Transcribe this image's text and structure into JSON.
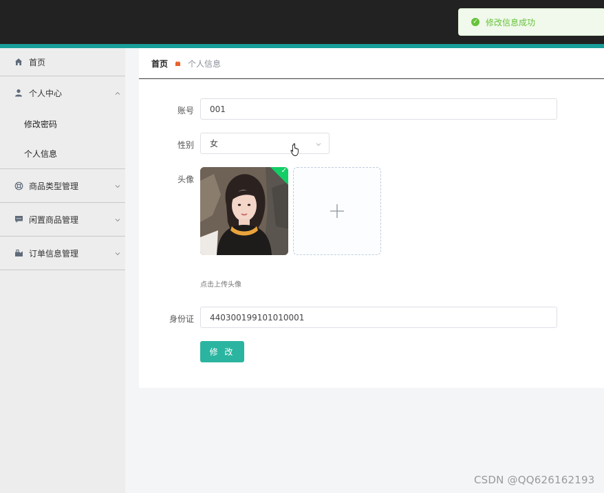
{
  "toast": {
    "message": "修改信息成功",
    "color": "#67c23a"
  },
  "theme": {
    "topbar": "#222222",
    "accent": "#179f9a",
    "button": "#2bb5a0"
  },
  "sidebar": {
    "home": {
      "label": "首页",
      "icon": "home-icon"
    },
    "personal_center": {
      "label": "个人中心",
      "icon": "user-icon",
      "expanded": true,
      "items": [
        {
          "label": "修改密码"
        },
        {
          "label": "个人信息"
        }
      ]
    },
    "menus": [
      {
        "label": "商品类型管理",
        "icon": "lifebuoy-icon"
      },
      {
        "label": "闲置商品管理",
        "icon": "chat-icon"
      },
      {
        "label": "订单信息管理",
        "icon": "order-icon"
      }
    ]
  },
  "breadcrumb": {
    "home": "首页",
    "current": "个人信息"
  },
  "form": {
    "account": {
      "label": "账号",
      "value": "001"
    },
    "gender": {
      "label": "性别",
      "value": "女"
    },
    "avatar": {
      "label": "头像",
      "tip": "点击上传头像"
    },
    "id_card": {
      "label": "身份证",
      "value": "440300199101010001"
    },
    "submit": "修 改"
  },
  "watermark": "CSDN @QQ626162193"
}
